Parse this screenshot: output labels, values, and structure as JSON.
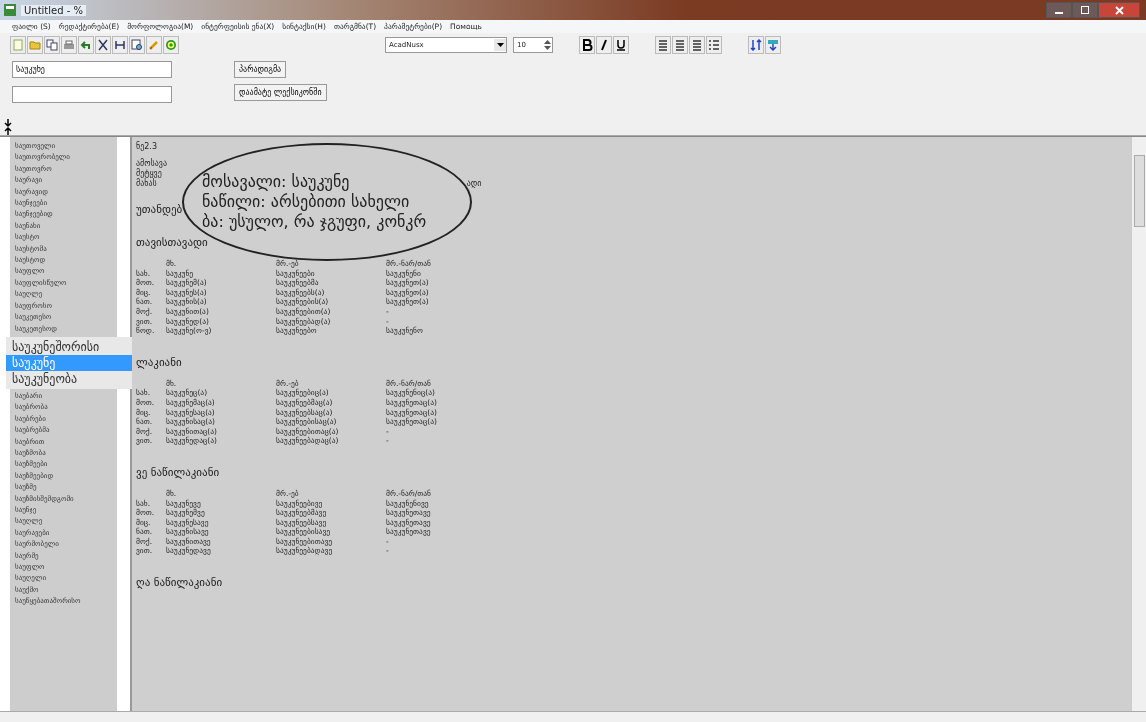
{
  "window": {
    "title": "Untitled - %"
  },
  "menu": [
    "ფაილი (S)",
    "რედაქტირება(E)",
    "მორფოლოგია(M)",
    "ინტერფეისის ენა(X)",
    "სინტაქსი(H)",
    "თარგმნა(T)",
    "პარამეტრები(P)",
    "Помощь"
  ],
  "toolbar": {
    "font": "AcadNusx",
    "size": "10"
  },
  "search": {
    "value": "საუკუნე"
  },
  "buttons": [
    "პარადიგმა",
    "დაამატე ლექსიკონში"
  ],
  "sidebar": {
    "items_before": [
      "საუთოველი",
      "საუთოვრობელი",
      "საუთოვრო",
      "საურავი",
      "საურავიდ",
      "საუნჯეები",
      "საუნჯეებიდ",
      "საუნახი",
      "საუსტო",
      "საუსტომა",
      "საუსტოდ",
      "საუფლო",
      "საუფლისწულო",
      "საუღლე",
      "საუფროსო",
      "საუკეთესო",
      "საუკეთესოდ"
    ],
    "popup": [
      {
        "label": "საუკუნეშორისი",
        "selected": false
      },
      {
        "label": "საუკუნე",
        "selected": true
      },
      {
        "label": "საუკუნეობა",
        "selected": false
      }
    ],
    "items_after": [
      "საუბარი",
      "საუბრობა",
      "საუბრები",
      "საუბრებმა",
      "საუბრით",
      "საუზმობა",
      "საუზმეები",
      "საუზმეებიდ",
      "საუზმე",
      "საუზმისშემდგომი",
      "საუნჯე",
      "საუღლე",
      "საურავები",
      "საურმობელი",
      "საურმე",
      "საუფლო",
      "საუღელი",
      "საუქმო",
      "საუწყებათაშორისო"
    ]
  },
  "content": {
    "code": "ნე2.3",
    "info_fragments": [
      {
        "left": "ამოსავა"
      },
      {
        "left": "მეტყვე"
      },
      {
        "left": "მახას",
        "right": "ადი"
      }
    ],
    "magnifier": [
      "მოსავალი: საუკუნე",
      "ნაწილი: არსებითი სახელი",
      "ბა: უსულო, რა ჯგუფი, კონკრ"
    ],
    "subtitle": "უთანდებ",
    "sections": [
      {
        "heading": "თავისთავადი",
        "columns": [
          "",
          "მხ.",
          "მრ.-ებ",
          "მრ.-ნარ/თან"
        ],
        "rows": [
          [
            "სახ.",
            "საუკუნე",
            "საუკუნეები",
            "საუკუნენი"
          ],
          [
            "მოთ.",
            "საუკუნემ(ა)",
            "საუკუნეებმა",
            "საუკუნეთ(ა)"
          ],
          [
            "მიც.",
            "საუკუნეს(ა)",
            "საუკუნეებს(ა)",
            "საუკუნეთ(ა)"
          ],
          [
            "ნათ.",
            "საუკუნის(ა)",
            "საუკუნეების(ა)",
            "საუკუნეთ(ა)"
          ],
          [
            "მოქ.",
            "საუკუნით(ა)",
            "საუკუნეებით(ა)",
            "-"
          ],
          [
            "ვით.",
            "საუკუნედ(ა)",
            "საუკუნეებად(ა)",
            "-"
          ],
          [
            "წოდ.",
            "საუკუნე(ო-ვ)",
            "საუკუნეებო",
            "საუკუნენო"
          ]
        ]
      },
      {
        "heading": "ლაკიანი",
        "columns": [
          "",
          "მხ.",
          "მრ.-ებ",
          "მრ.-ნარ/თან"
        ],
        "rows": [
          [
            "სახ.",
            "საუკუნეც(ა)",
            "საუკუნეებიც(ა)",
            "საუკუნენიც(ა)"
          ],
          [
            "მოთ.",
            "საუკუნემაც(ა)",
            "საუკუნეებმაც(ა)",
            "საუკუნეთაც(ა)"
          ],
          [
            "მიც.",
            "საუკუნესაც(ა)",
            "საუკუნეებსაც(ა)",
            "საუკუნეთაც(ა)"
          ],
          [
            "ნათ.",
            "საუკუნისაც(ა)",
            "საუკუნეებისაც(ა)",
            "საუკუნეთაც(ა)"
          ],
          [
            "მოქ.",
            "საუკუნითაც(ა)",
            "საუკუნეებითაც(ა)",
            "-"
          ],
          [
            "ვით.",
            "საუკუნედაც(ა)",
            "საუკუნეებადაც(ა)",
            "-"
          ]
        ]
      },
      {
        "heading": "ვე ნაწილაკიანი",
        "columns": [
          "",
          "მხ.",
          "მრ.-ებ",
          "მრ.-ნარ/თან"
        ],
        "rows": [
          [
            "სახ.",
            "საუკუნევე",
            "საუკუნეებივე",
            "საუკუნენივე"
          ],
          [
            "მოთ.",
            "საუკუნემვე",
            "საუკუნეებმავე",
            "საუკუნეთავე"
          ],
          [
            "მიც.",
            "საუკუნესავე",
            "საუკუნეებსავე",
            "საუკუნეთავე"
          ],
          [
            "ნათ.",
            "საუკუნისავე",
            "საუკუნეებისავე",
            "საუკუნეთავე"
          ],
          [
            "მოქ.",
            "საუკუნითავე",
            "საუკუნეებითავე",
            "-"
          ],
          [
            "ვით.",
            "საუკუნედავე",
            "საუკუნეებადავე",
            "-"
          ]
        ]
      },
      {
        "heading": "ღა ნაწილაკიანი"
      }
    ]
  }
}
